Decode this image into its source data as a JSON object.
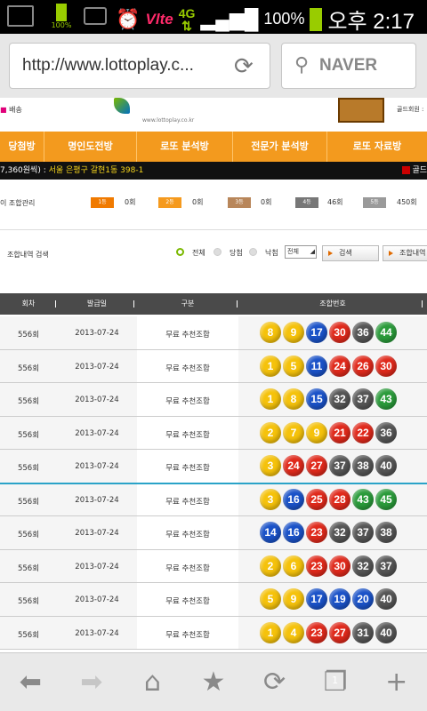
{
  "status": {
    "battery_small_pct": "100%",
    "network": "Vlte",
    "signal": "4G",
    "battery_pct": "100%",
    "time": "오후 2:17"
  },
  "browser": {
    "url": "http://www.lottoplay.c...",
    "search_label": "NAVER"
  },
  "header": {
    "left_text": "배송",
    "logo_sub": "www.lottoplay.co.kr",
    "right_text": "골드회원 :"
  },
  "nav": {
    "items": [
      "당첨방",
      "명인도전방",
      "로또 분석방",
      "전문가 분석방",
      "로또 자료방"
    ]
  },
  "info": {
    "prefix": "7,360원씩) : ",
    "address": "서울 은평구 갈현1동 398-1",
    "right": "골드"
  },
  "stats": {
    "label": "이 조합관리",
    "ranks": [
      {
        "name": "1등",
        "count": "0회",
        "color": "#f07a00"
      },
      {
        "name": "2등",
        "count": "0회",
        "color": "#f59a1e"
      },
      {
        "name": "3등",
        "count": "0회",
        "color": "#b8865a"
      },
      {
        "name": "4등",
        "count": "46회",
        "color": "#777777"
      },
      {
        "name": "5등",
        "count": "450회",
        "color": "#9a9a9a"
      }
    ]
  },
  "search": {
    "label": "조합내역 검색",
    "radio_all": "전체",
    "radio_win": "당첨",
    "radio_lose": "낙첨",
    "select_value": "전체",
    "search_btn": "검색",
    "history_btn": "조합내역"
  },
  "table": {
    "headers": [
      "회차",
      "발급일",
      "구분",
      "조합번호"
    ],
    "rows": [
      {
        "round": "556회",
        "date": "2013-07-24",
        "type": "무료 추천조합",
        "numbers": [
          "8",
          "9",
          "17",
          "30",
          "36",
          "44"
        ]
      },
      {
        "round": "556회",
        "date": "2013-07-24",
        "type": "무료 추천조합",
        "numbers": [
          "1",
          "5",
          "11",
          "24",
          "26",
          "30"
        ]
      },
      {
        "round": "556회",
        "date": "2013-07-24",
        "type": "무료 추천조합",
        "numbers": [
          "1",
          "8",
          "15",
          "32",
          "37",
          "43"
        ]
      },
      {
        "round": "556회",
        "date": "2013-07-24",
        "type": "무료 추천조합",
        "numbers": [
          "2",
          "7",
          "9",
          "21",
          "22",
          "36"
        ]
      },
      {
        "round": "556회",
        "date": "2013-07-24",
        "type": "무료 추천조합",
        "numbers": [
          "3",
          "24",
          "27",
          "37",
          "38",
          "40"
        ]
      },
      {
        "round": "556회",
        "date": "2013-07-24",
        "type": "무료 추천조합",
        "numbers": [
          "3",
          "16",
          "25",
          "28",
          "43",
          "45"
        ]
      },
      {
        "round": "556회",
        "date": "2013-07-24",
        "type": "무료 추천조합",
        "numbers": [
          "14",
          "16",
          "23",
          "32",
          "37",
          "38"
        ]
      },
      {
        "round": "556회",
        "date": "2013-07-24",
        "type": "무료 추천조합",
        "numbers": [
          "2",
          "6",
          "23",
          "30",
          "32",
          "37"
        ]
      },
      {
        "round": "556회",
        "date": "2013-07-24",
        "type": "무료 추천조합",
        "numbers": [
          "5",
          "9",
          "17",
          "19",
          "20",
          "40"
        ]
      },
      {
        "round": "556회",
        "date": "2013-07-24",
        "type": "무료 추천조합",
        "numbers": [
          "1",
          "4",
          "23",
          "27",
          "31",
          "40"
        ]
      }
    ]
  },
  "toolbar": {
    "tab_count": "1"
  }
}
